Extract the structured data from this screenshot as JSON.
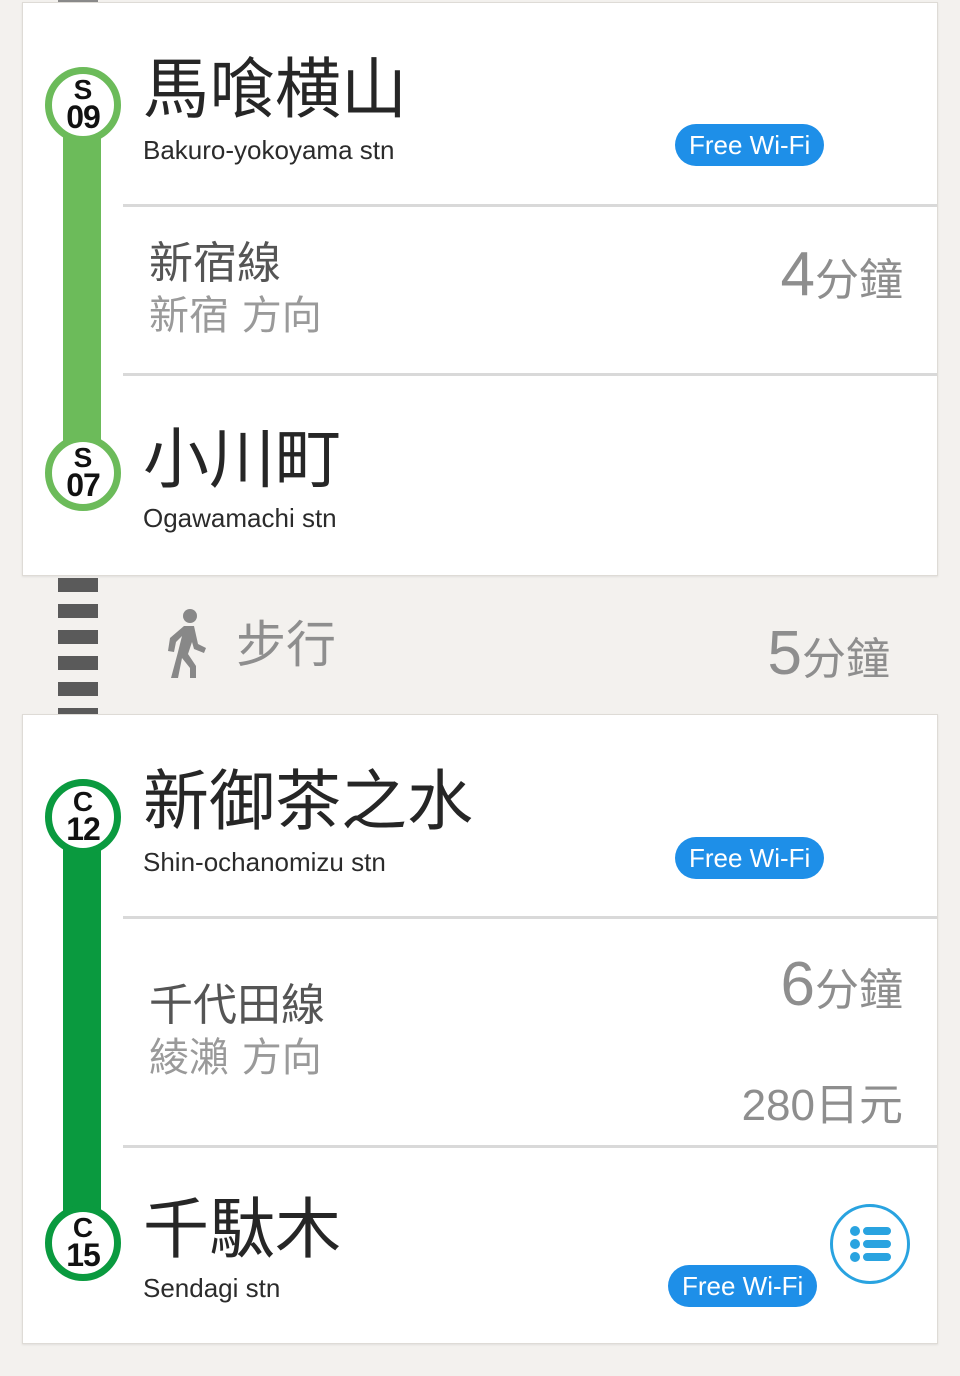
{
  "colors": {
    "shinjuku_line": "#6cbb5a",
    "chiyoda_line": "#0a9a3f",
    "wifi_badge": "#1e8fe8",
    "menu_icon": "#29a3e0"
  },
  "segment1": {
    "from": {
      "code_letter": "S",
      "code_number": "09",
      "name": "馬喰横山",
      "name_en": "Bakuro-yokoyama stn",
      "wifi": "Free Wi-Fi"
    },
    "line": {
      "name": "新宿線",
      "direction": "新宿 方向",
      "time_num": "4",
      "time_unit": "分鐘"
    },
    "to": {
      "code_letter": "S",
      "code_number": "07",
      "name": "小川町",
      "name_en": "Ogawamachi stn"
    }
  },
  "walk": {
    "icon": "walking-person-icon",
    "label": "步行",
    "time_num": "5",
    "time_unit": "分鐘"
  },
  "segment2": {
    "from": {
      "code_letter": "C",
      "code_number": "12",
      "name": "新御茶之水",
      "name_en": "Shin-ochanomizu stn",
      "wifi": "Free Wi-Fi"
    },
    "line": {
      "name": "千代田線",
      "direction": "綾瀨 方向",
      "time_num": "6",
      "time_unit": "分鐘",
      "fare_num": "280",
      "fare_unit": "日元"
    },
    "to": {
      "code_letter": "C",
      "code_number": "15",
      "name": "千駄木",
      "name_en": "Sendagi stn",
      "wifi": "Free Wi-Fi"
    }
  },
  "menu_button": {
    "icon": "list-menu-icon"
  }
}
